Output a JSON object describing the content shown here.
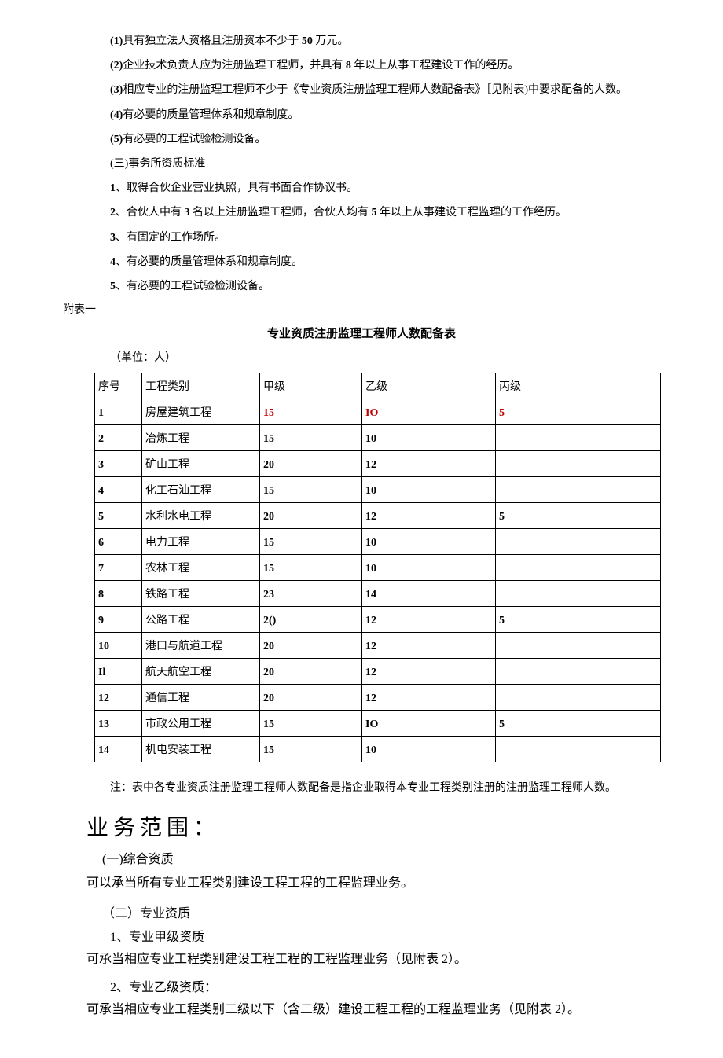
{
  "lines": {
    "l1a": "(1)",
    "l1b": "具有独立法人资格且注册资本不少于 ",
    "l1c": "50 ",
    "l1d": "万元。",
    "l2a": "(2)",
    "l2b": "企业技术负责人应为注册监理工程师，并具有 ",
    "l2c": "8 ",
    "l2d": "年以上从事工程建设工作的经历。",
    "l3a": "(3)",
    "l3b": "相应专业的注册监理工程师不少于《专业资质注册监理工程师人数配备表》［见附表)中要求配备的人数。",
    "l4a": "(4)",
    "l4b": "有必要的质量管理体系和规章制度。",
    "l5a": "(5)",
    "l5b": "有必要的工程试验检测设备。",
    "l6": "(三)事务所资质标准",
    "l7a": "1",
    "l7b": "、取得合伙企业营业执照，具有书面合作协议书。",
    "l8a": "2",
    "l8b": "、合伙人中有 ",
    "l8c": "3 ",
    "l8d": "名以上注册监理工程师，合伙人均有 ",
    "l8e": "5 ",
    "l8f": "年以上从事建设工程监理的工作经历。",
    "l9a": "3",
    "l9b": "、有固定的工作场所。",
    "l10a": "4",
    "l10b": "、有必要的质量管理体系和规章制度。",
    "l11a": "5",
    "l11b": "、有必要的工程试验检测设备。"
  },
  "attach_label": "附表一",
  "table_title": "专业资质注册监理工程师人数配备表",
  "unit": "（单位：人）",
  "headers": {
    "seq": "序号",
    "cat": "工程类别",
    "a": "甲级",
    "b": "乙级",
    "c": "丙级"
  },
  "rows": [
    {
      "seq": "1",
      "cat": "房屋建筑工程",
      "a": "15",
      "b": "IO",
      "c": "5",
      "red": true
    },
    {
      "seq": "2",
      "cat": "冶炼工程",
      "a": "15",
      "b": "10",
      "c": ""
    },
    {
      "seq": "3",
      "cat": "矿山工程",
      "a": "20",
      "b": "12",
      "c": ""
    },
    {
      "seq": "4",
      "cat": "化工石油工程",
      "a": "15",
      "b": "10",
      "c": ""
    },
    {
      "seq": "5",
      "cat": "水利水电工程",
      "a": "20",
      "b": "12",
      "c": "5"
    },
    {
      "seq": "6",
      "cat": "电力工程",
      "a": "15",
      "b": "10",
      "c": ""
    },
    {
      "seq": "7",
      "cat": "农林工程",
      "a": "15",
      "b": "10",
      "c": ""
    },
    {
      "seq": "8",
      "cat": "铁路工程",
      "a": "23",
      "b": "14",
      "c": ""
    },
    {
      "seq": "9",
      "cat": "公路工程",
      "a": "2()",
      "b": "12",
      "c": "5"
    },
    {
      "seq": "10",
      "cat": "港口与航道工程",
      "a": "20",
      "b": "12",
      "c": ""
    },
    {
      "seq": "Il",
      "cat": "航天航空工程",
      "a": "20",
      "b": "12",
      "c": ""
    },
    {
      "seq": "12",
      "cat": "通信工程",
      "a": "20",
      "b": "12",
      "c": ""
    },
    {
      "seq": "13",
      "cat": "市政公用工程",
      "a": "15",
      "b": "IO",
      "c": "5"
    },
    {
      "seq": "14",
      "cat": "机电安装工程",
      "a": "15",
      "b": "10",
      "c": ""
    }
  ],
  "note": "注：表中各专业资质注册监理工程师人数配备是指企业取得本专业工程类别注册的注册监理工程师人数。",
  "scope": {
    "heading": "业务范围：",
    "s1": "(一)综合资质",
    "p1": "可以承当所有专业工程类别建设工程工程的工程监理业务。",
    "s2": "（二）专业资质",
    "s2a": "1、专业甲级资质",
    "p2": "可承当相应专业工程类别建设工程工程的工程监理业务（见附表 2）。",
    "s2b": "2、专业乙级资质：",
    "p3": "可承当相应专业工程类别二级以下（含二级）建设工程工程的工程监理业务（见附表 2）。"
  }
}
